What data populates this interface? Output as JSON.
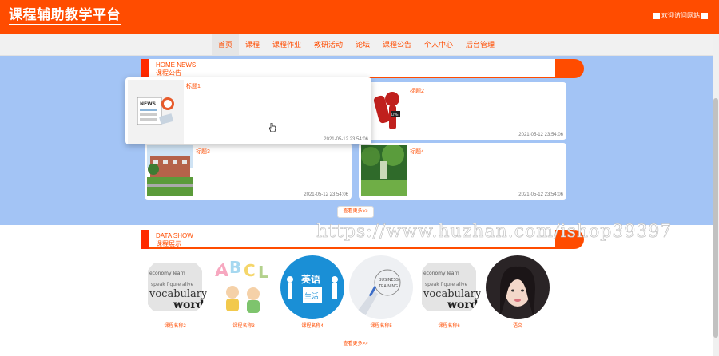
{
  "header": {
    "title": "课程辅助教学平台",
    "welcome": "欢迎访问网站"
  },
  "nav": [
    "首页",
    "课程",
    "课程作业",
    "教研活动",
    "论坛",
    "课程公告",
    "个人中心",
    "后台管理"
  ],
  "news": {
    "heading_en": "HOME NEWS",
    "heading_cn": "课程公告",
    "items": [
      {
        "title": "标题1",
        "date": "2021-05-12 23:54:06"
      },
      {
        "title": "标题2",
        "date": "2021-05-12 23:54:06"
      },
      {
        "title": "标题3",
        "date": "2021-05-12 23:54:06"
      },
      {
        "title": "标题4",
        "date": "2021-05-12 23:54:06"
      }
    ],
    "more": "查看更多>>"
  },
  "show": {
    "heading_en": "DATA SHOW",
    "heading_cn": "课程展示",
    "items": [
      "课程名称2",
      "课程名称3",
      "课程名称4",
      "课程名称5",
      "课程名称6",
      "语文"
    ],
    "more": "查看更多>>"
  },
  "watermark": "https://www.huzhan.com/ishop39397",
  "colors": {
    "accent": "#ff4c00",
    "news_bg": "#a3c4f5"
  }
}
